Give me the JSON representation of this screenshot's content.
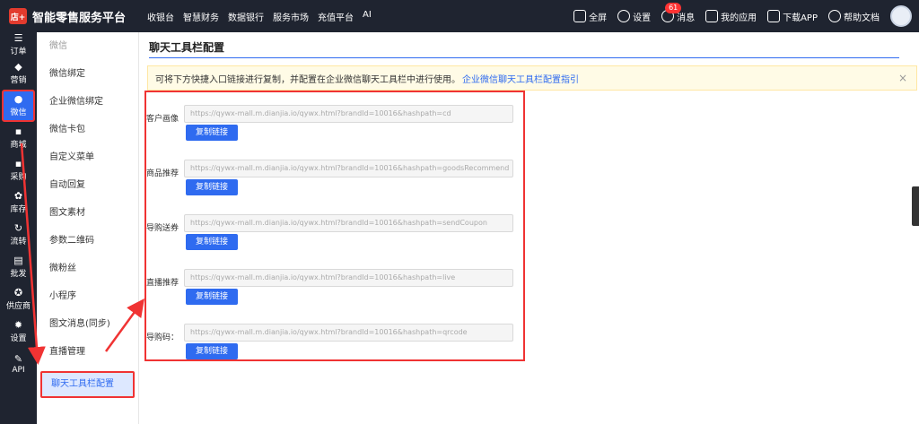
{
  "header": {
    "logo_text": "店+",
    "brand": "智能零售服务平台",
    "nav": [
      "收银台",
      "智慧财务",
      "数据银行",
      "服务市场",
      "充值平台",
      "AI"
    ],
    "right": {
      "fullscreen": "全屏",
      "settings": "设置",
      "messages": "消息",
      "message_count": "61",
      "my_apps": "我的应用",
      "download_app": "下载APP",
      "help_docs": "帮助文档"
    }
  },
  "sidebar": {
    "items": [
      {
        "icon": "☰",
        "label": "订单"
      },
      {
        "icon": "◆",
        "label": "营销"
      },
      {
        "icon": "●",
        "label": "微信"
      },
      {
        "icon": "▪",
        "label": "商城"
      },
      {
        "icon": "▪",
        "label": "采购"
      },
      {
        "icon": "✿",
        "label": "库存"
      },
      {
        "icon": "↻",
        "label": "流转"
      },
      {
        "icon": "▤",
        "label": "批发"
      },
      {
        "icon": "✪",
        "label": "供应商"
      },
      {
        "icon": "✹",
        "label": "设置"
      },
      {
        "icon": "✎",
        "label": "API"
      }
    ]
  },
  "subnav": {
    "header": "微信",
    "items": [
      "微信绑定",
      "企业微信绑定",
      "微信卡包",
      "自定义菜单",
      "自动回复",
      "图文素材",
      "参数二维码",
      "微粉丝",
      "小程序",
      "图文消息(同步)",
      "直播管理"
    ],
    "active": "聊天工具栏配置"
  },
  "main": {
    "title": "聊天工具栏配置",
    "notice_text": "可将下方快捷入口链接进行复制，并配置在企业微信聊天工具栏中进行使用。",
    "notice_link": "企业微信聊天工具栏配置指引",
    "notice_close": "×",
    "copy_label": "复制链接",
    "rows": [
      {
        "label": "客户画像",
        "url": "https://qywx-mall.m.dianjia.io/qywx.html?brandId=10016&hashpath=cd"
      },
      {
        "label": "商品推荐",
        "url": "https://qywx-mall.m.dianjia.io/qywx.html?brandId=10016&hashpath=goodsRecommend"
      },
      {
        "label": "导购送券",
        "url": "https://qywx-mall.m.dianjia.io/qywx.html?brandId=10016&hashpath=sendCoupon"
      },
      {
        "label": "直播推荐",
        "url": "https://qywx-mall.m.dianjia.io/qywx.html?brandId=10016&hashpath=live"
      },
      {
        "label": "导购码：",
        "url": "https://qywx-mall.m.dianjia.io/qywx.html?brandId=10016&hashpath=qrcode"
      }
    ]
  },
  "colors": {
    "topbar": "#1f2430",
    "accent": "#2f6bf0",
    "annotation": "#f03333",
    "notice_bg": "#fffbe6"
  }
}
